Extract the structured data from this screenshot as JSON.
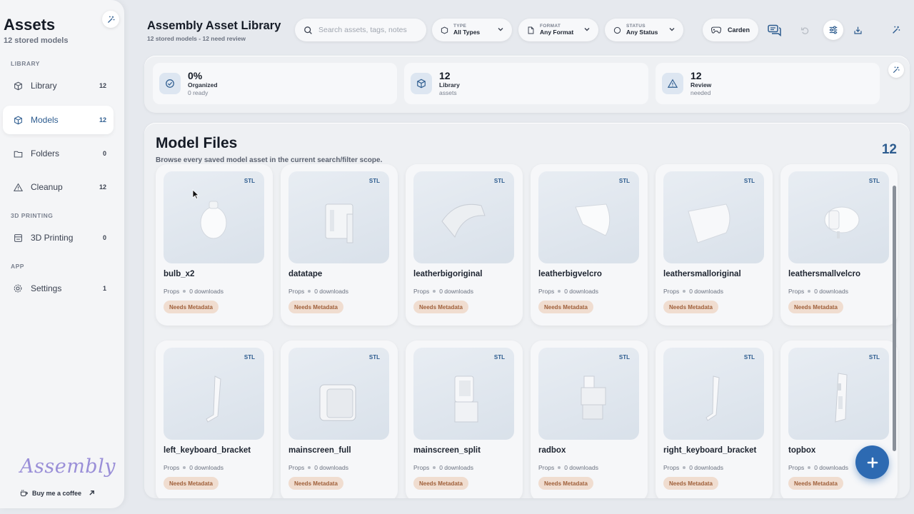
{
  "sidebar": {
    "title": "Assets",
    "subtitle": "12 stored models",
    "sections": {
      "library": "LIBRARY",
      "printing": "3D PRINTING",
      "app": "APP"
    },
    "items": [
      {
        "label": "Library",
        "count": "12",
        "icon": "cube-icon"
      },
      {
        "label": "Models",
        "count": "12",
        "icon": "box-icon",
        "active": true
      },
      {
        "label": "Folders",
        "count": "0",
        "icon": "folder-icon"
      },
      {
        "label": "Cleanup",
        "count": "12",
        "icon": "warning-icon"
      },
      {
        "label": "3D Printing",
        "count": "0",
        "icon": "printer-icon"
      },
      {
        "label": "Settings",
        "count": "1",
        "icon": "gear-icon"
      }
    ],
    "logo": "Assembly",
    "coffee": "Buy me a coffee"
  },
  "header": {
    "title": "Assembly Asset Library",
    "subtitle": "12 stored models - 12 need review",
    "search_placeholder": "Search assets, tags, notes",
    "filters": [
      {
        "key": "TYPE",
        "value": "All Types"
      },
      {
        "key": "FORMAT",
        "value": "Any Format"
      },
      {
        "key": "STATUS",
        "value": "Any Status"
      }
    ],
    "user": "Carden"
  },
  "stats": [
    {
      "value": "0%",
      "label": "Organized",
      "detail": "0 ready",
      "icon": "check-circle-icon"
    },
    {
      "value": "12",
      "label": "Library",
      "detail": "assets",
      "icon": "cube-icon"
    },
    {
      "value": "12",
      "label": "Review",
      "detail": "needed",
      "icon": "warning-icon"
    }
  ],
  "files": {
    "title": "Model Files",
    "subtitle": "Browse every saved model asset in the current search/filter scope.",
    "count": "12",
    "meta_category": "Props",
    "meta_downloads": "0 downloads",
    "badge": "Needs Metadata",
    "cards": [
      {
        "name": "bulb_x2",
        "format": "STL"
      },
      {
        "name": "datatape",
        "format": "STL"
      },
      {
        "name": "leatherbigoriginal",
        "format": "STL"
      },
      {
        "name": "leatherbigvelcro",
        "format": "STL"
      },
      {
        "name": "leathersmalloriginal",
        "format": "STL"
      },
      {
        "name": "leathersmallvelcro",
        "format": "STL"
      },
      {
        "name": "left_keyboard_bracket",
        "format": "STL"
      },
      {
        "name": "mainscreen_full",
        "format": "STL"
      },
      {
        "name": "mainscreen_split",
        "format": "STL"
      },
      {
        "name": "radbox",
        "format": "STL"
      },
      {
        "name": "right_keyboard_bracket",
        "format": "STL"
      },
      {
        "name": "topbox",
        "format": "STL"
      }
    ]
  },
  "colors": {
    "accent": "#2d5c8f",
    "fab": "#2d6ab2",
    "badge_bg": "#f0ddd0",
    "badge_text": "#a0603a"
  }
}
